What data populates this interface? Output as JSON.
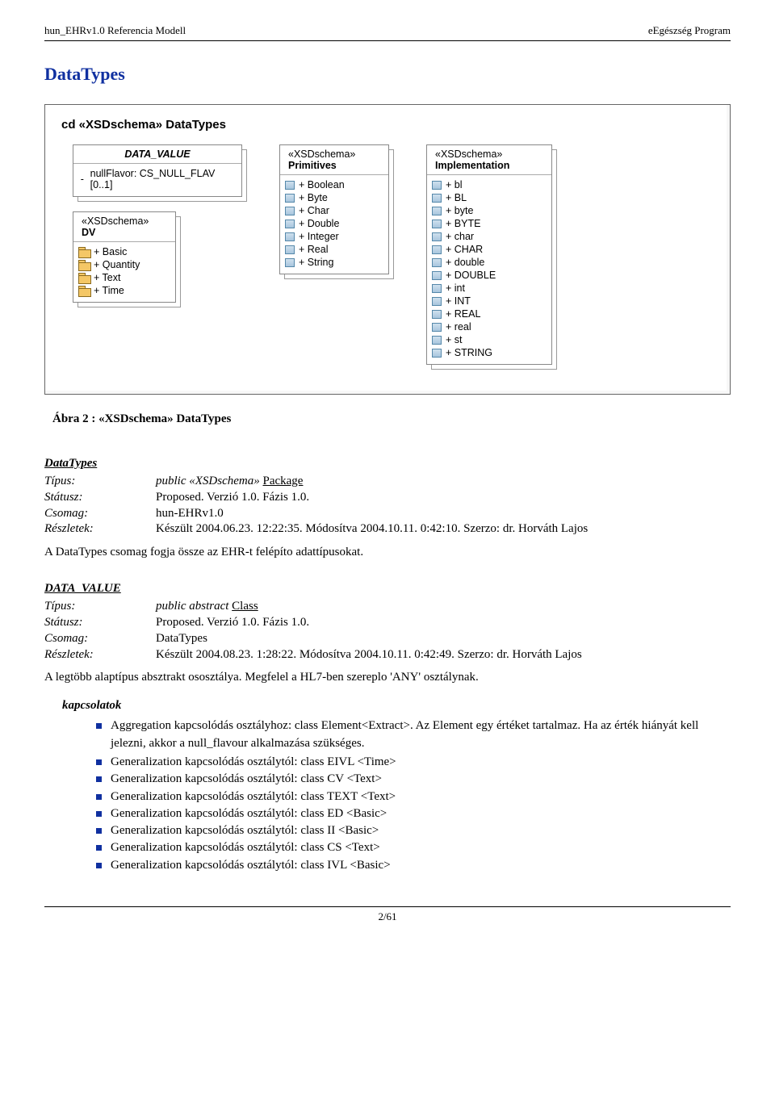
{
  "header": {
    "left": "hun_EHRv1.0 Referencia Modell",
    "right": "eEgészség Program"
  },
  "section_title": "DataTypes",
  "diagram": {
    "title": "cd «XSDschema» DataTypes",
    "data_value": {
      "title": "DATA_VALUE",
      "attr": "nullFlavor:  CS_NULL_FLAV [0..1]"
    },
    "dv": {
      "stereo": "«XSDschema»",
      "title": "DV",
      "items": [
        "Basic",
        "Quantity",
        "Text",
        "Time"
      ]
    },
    "prim": {
      "stereo": "«XSDschema»",
      "title": "Primitives",
      "items": [
        "Boolean",
        "Byte",
        "Char",
        "Double",
        "Integer",
        "Real",
        "String"
      ]
    },
    "impl": {
      "stereo": "«XSDschema»",
      "title": "Implementation",
      "items": [
        "bl",
        "BL",
        "byte",
        "BYTE",
        "char",
        "CHAR",
        "double",
        "DOUBLE",
        "int",
        "INT",
        "REAL",
        "real",
        "st",
        "STRING"
      ]
    }
  },
  "figure_caption": "Ábra 2 : «XSDschema» DataTypes",
  "def1": {
    "name": "DataTypes",
    "labels": {
      "tipus": "Típus:",
      "statusz": "Státusz:",
      "csomag": "Csomag:",
      "reszletek": "Részletek:"
    },
    "tipus_pre": "public «XSDschema» ",
    "tipus_link": "Package",
    "statusz": "Proposed.  Verzió 1.0.  Fázis 1.0.",
    "csomag": "hun-EHRv1.0",
    "reszletek": "Készült 2004.06.23. 12:22:35. Módosítva 2004.10.11. 0:42:10. Szerzo: dr. Horváth Lajos",
    "desc": "A DataTypes csomag fogja össze az EHR-t felépíto adattípusokat."
  },
  "def2": {
    "name": "DATA_VALUE",
    "labels": {
      "tipus": "Típus:",
      "statusz": "Státusz:",
      "csomag": "Csomag:",
      "reszletek": "Részletek:"
    },
    "tipus_pre": "public abstract ",
    "tipus_link": "Class",
    "statusz": "Proposed.  Verzió 1.0.  Fázis 1.0.",
    "csomag": "DataTypes",
    "reszletek": "Készült 2004.08.23. 1:28:22. Módosítva 2004.10.11. 0:42:49. Szerzo: dr. Horváth Lajos",
    "desc": "A legtöbb alaptípus absztrakt ososztálya. Megfelel a HL7-ben szereplo 'ANY' osztálynak.",
    "kapcsolatok_label": "kapcsolatok",
    "rels": [
      "Aggregation kapcsolódás osztályhoz: class Element<Extract>. Az Element egy értéket tartalmaz. Ha az érték hiányát kell jelezni, akkor a null_flavour alkalmazása szükséges.",
      "Generalization kapcsolódás osztálytól: class EIVL <Time>",
      "Generalization kapcsolódás osztálytól: class CV <Text>",
      "Generalization kapcsolódás osztálytól: class TEXT <Text>",
      "Generalization kapcsolódás osztálytól: class ED <Basic>",
      "Generalization kapcsolódás osztálytól: class II <Basic>",
      "Generalization kapcsolódás osztálytól: class CS <Text>",
      "Generalization kapcsolódás osztálytól: class IVL <Basic>"
    ]
  },
  "footer": "2/61"
}
